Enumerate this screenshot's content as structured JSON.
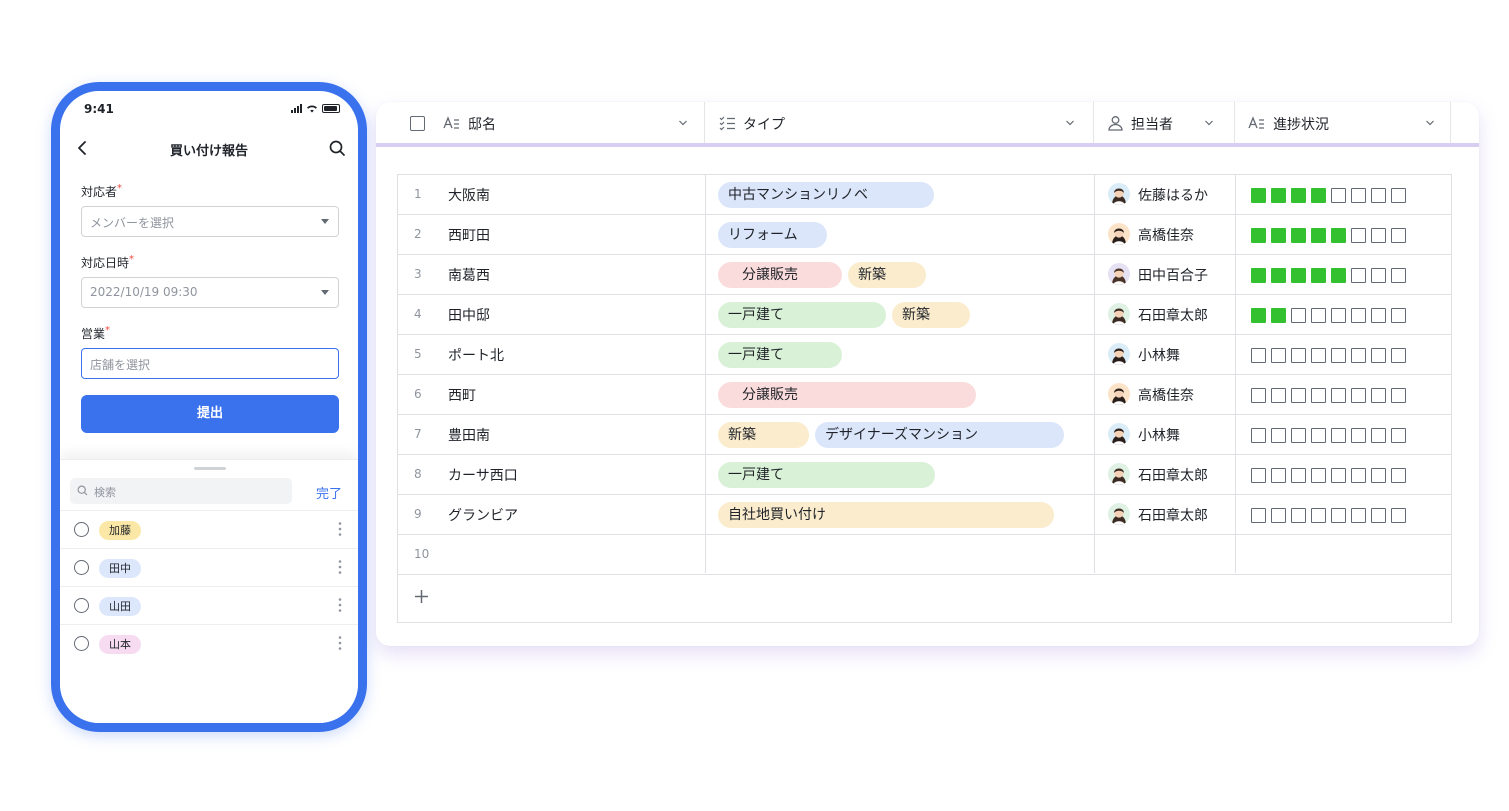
{
  "phone": {
    "time": "9:41",
    "title": "買い付け報告",
    "fields": [
      {
        "label": "対応者",
        "required": "*",
        "value": "メンバーを選択"
      },
      {
        "label": "対応日時",
        "required": "*",
        "value": "2022/10/19 09:30"
      },
      {
        "label": "営業",
        "required": "*",
        "value": "店舗を選択"
      }
    ],
    "submit_label": "提出",
    "sheet": {
      "search_placeholder": "検索",
      "done_label": "完了",
      "options": [
        {
          "label": "加藤",
          "color": "#fbe7a6"
        },
        {
          "label": "田中",
          "color": "#dde7fb"
        },
        {
          "label": "山田",
          "color": "#dde7fb"
        },
        {
          "label": "山本",
          "color": "#f7dcf1"
        }
      ]
    }
  },
  "table": {
    "columns": [
      {
        "icon": "text-field-icon",
        "label": "邸名"
      },
      {
        "icon": "checklist-icon",
        "label": "タイプ"
      },
      {
        "icon": "person-icon",
        "label": "担当者"
      },
      {
        "icon": "text-field-icon",
        "label": "進捗状況"
      }
    ],
    "progress_total": 8,
    "colors": {
      "progress_on": "#33c12f",
      "accent": "#3a72ee",
      "header_bar": "#d8cdf3"
    },
    "rows": [
      {
        "num": "1",
        "name": "大阪南",
        "tags": [
          {
            "label": "中古マンションリノベ",
            "color": "#dce6fb",
            "pad": false,
            "w": 216
          }
        ],
        "person": "佐藤はるか",
        "progress": 4
      },
      {
        "num": "2",
        "name": "西町田",
        "tags": [
          {
            "label": "リフォーム",
            "color": "#dce6fb",
            "pad": false,
            "w": 109
          }
        ],
        "person": "高橋佳奈",
        "progress": 5
      },
      {
        "num": "3",
        "name": "南葛西",
        "tags": [
          {
            "label": "分譲販売",
            "color": "#fbdcdc",
            "pad": true,
            "w": 124
          },
          {
            "label": "新築",
            "color": "#faeccd",
            "pad": false,
            "w": 78
          }
        ],
        "person": "田中百合子",
        "progress": 5
      },
      {
        "num": "4",
        "name": "田中邸",
        "tags": [
          {
            "label": "一戸建て",
            "color": "#d9f1d7",
            "pad": false,
            "w": 168
          },
          {
            "label": "新築",
            "color": "#faeccd",
            "pad": false,
            "w": 78
          }
        ],
        "person": "石田章太郎",
        "progress": 2
      },
      {
        "num": "5",
        "name": "ポート北",
        "tags": [
          {
            "label": "一戸建て",
            "color": "#d9f1d7",
            "pad": false,
            "w": 124
          }
        ],
        "person": "小林舞",
        "progress": 0
      },
      {
        "num": "6",
        "name": "西町",
        "tags": [
          {
            "label": "分譲販売",
            "color": "#fbdcdc",
            "pad": true,
            "w": 258
          }
        ],
        "person": "高橋佳奈",
        "progress": 0
      },
      {
        "num": "7",
        "name": "豊田南",
        "tags": [
          {
            "label": "新築",
            "color": "#faeccd",
            "pad": false,
            "w": 91
          },
          {
            "label": "デザイナーズマンション",
            "color": "#dce6fb",
            "pad": false,
            "w": 249
          }
        ],
        "person": "小林舞",
        "progress": 0
      },
      {
        "num": "8",
        "name": "カーサ西口",
        "tags": [
          {
            "label": "一戸建て",
            "color": "#d9f1d7",
            "pad": false,
            "w": 217
          }
        ],
        "person": "石田章太郎",
        "progress": 0
      },
      {
        "num": "9",
        "name": "グランビア",
        "tags": [
          {
            "label": "自社地買い付け",
            "color": "#faeccd",
            "pad": false,
            "w": 336
          }
        ],
        "person": "石田章太郎",
        "progress": 0
      },
      {
        "num": "10",
        "name": "",
        "tags": [],
        "person": "",
        "progress": null
      }
    ]
  }
}
